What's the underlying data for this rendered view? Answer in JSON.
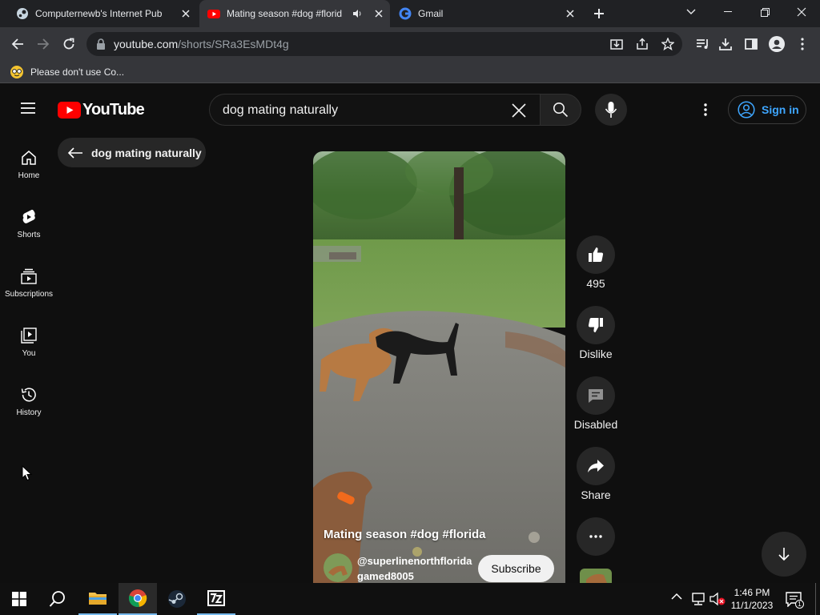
{
  "browser": {
    "tabs": [
      {
        "title": "Computernewb's Internet Pub H",
        "active": false
      },
      {
        "title": "Mating season #dog #florid",
        "active": true
      },
      {
        "title": "Gmail",
        "active": false
      }
    ],
    "url_host": "youtube.com",
    "url_path": "/shorts/SRa3EsMDt4g",
    "bookmark": "Please don't use Co..."
  },
  "youtube": {
    "logo_text": "YouTube",
    "search_query": "dog mating naturally",
    "sign_in": "Sign in",
    "back_chip": "dog mating naturally",
    "sidebar": [
      {
        "label": "Home",
        "icon": "home-icon"
      },
      {
        "label": "Shorts",
        "icon": "shorts-icon"
      },
      {
        "label": "Subscriptions",
        "icon": "subscriptions-icon"
      },
      {
        "label": "You",
        "icon": "you-icon"
      },
      {
        "label": "History",
        "icon": "history-icon"
      }
    ]
  },
  "short": {
    "title": "Mating season #dog #florida",
    "channel": "@superlinenorthfloridagamed8005",
    "subscribe": "Subscribe",
    "likes": "495",
    "dislike": "Dislike",
    "comments": "Disabled",
    "share": "Share"
  },
  "taskbar": {
    "time": "1:46 PM",
    "date": "11/1/2023",
    "notifications": "1"
  },
  "colors": {
    "youtube_red": "#ff0000",
    "link_blue": "#3ea6ff",
    "background": "#0f0f0f"
  }
}
